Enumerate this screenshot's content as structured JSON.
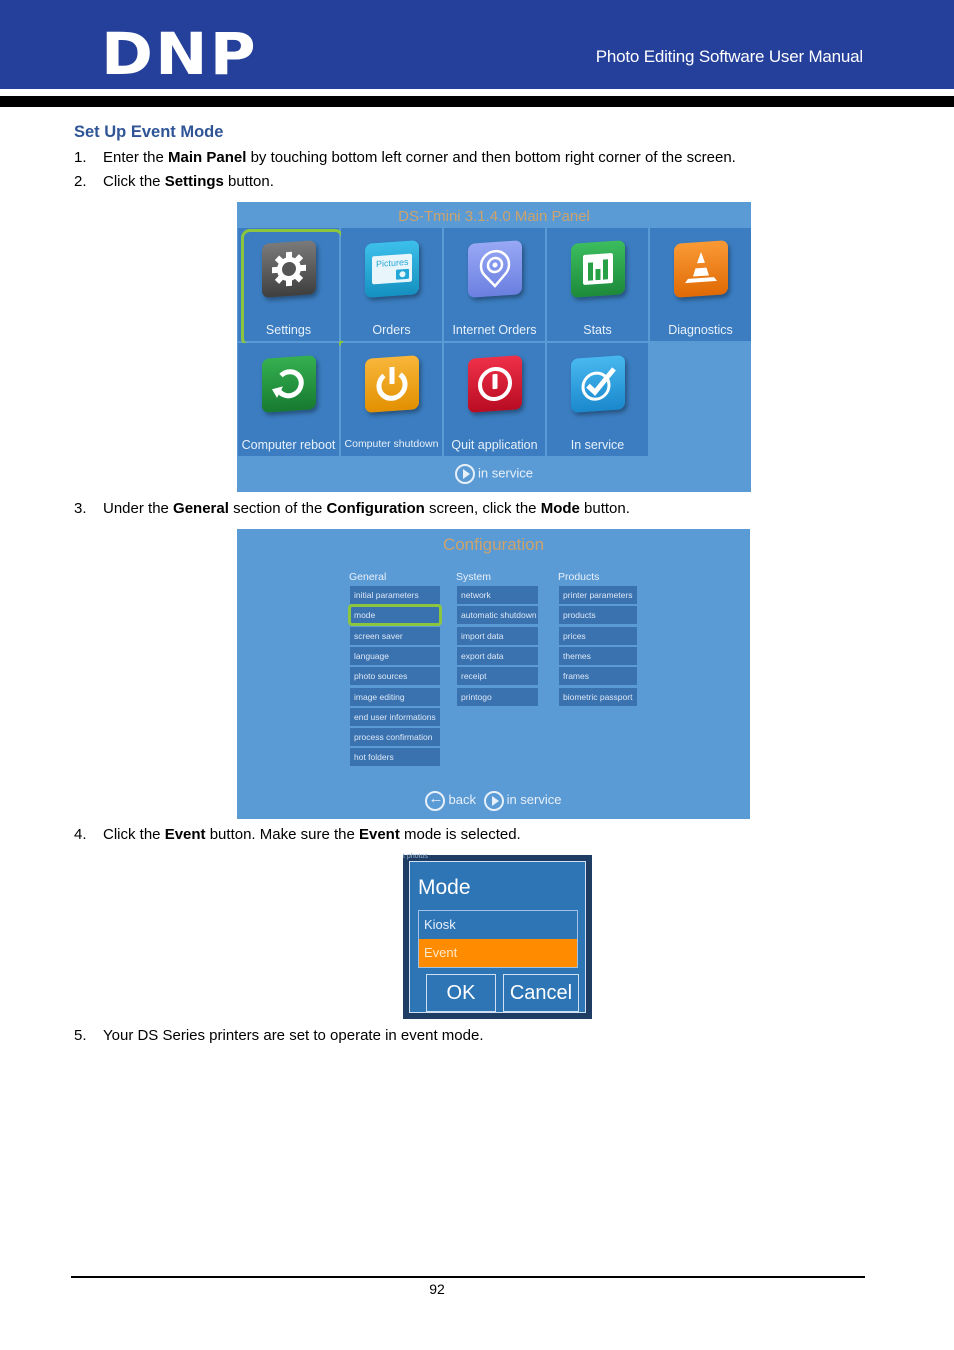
{
  "header": {
    "logo": "DNP",
    "manual_title": "Photo Editing Software User Manual",
    "colors": {
      "banner": "#24409a",
      "rule": "#000000"
    }
  },
  "section": {
    "title": "Set Up Event Mode",
    "title_color": "#2f5597"
  },
  "steps": [
    {
      "num": "1.",
      "parts": [
        {
          "t": "Enter the "
        },
        {
          "b": "Main Panel"
        },
        {
          "t": " by touching bottom left corner and then bottom right corner of the screen."
        }
      ]
    },
    {
      "num": "2.",
      "parts": [
        {
          "t": "Click the "
        },
        {
          "b": "Settings"
        },
        {
          "t": " button."
        }
      ]
    },
    {
      "num": "3.",
      "parts": [
        {
          "t": "Under the "
        },
        {
          "b": "General"
        },
        {
          "t": " section of the "
        },
        {
          "b": "Configuration"
        },
        {
          "t": " screen, click the "
        },
        {
          "b": "Mode"
        },
        {
          "t": " button."
        }
      ]
    },
    {
      "num": "4.",
      "parts": [
        {
          "t": "Click the "
        },
        {
          "b": "Event"
        },
        {
          "t": " button. Make sure the "
        },
        {
          "b": "Event"
        },
        {
          "t": " mode is selected."
        }
      ]
    },
    {
      "num": "5.",
      "parts": [
        {
          "t": "Your DS Series printers are set to operate in event mode."
        }
      ]
    }
  ],
  "main_panel": {
    "title": "DS-Tmini 3.1.4.0 Main Panel",
    "tiles": [
      {
        "label": "Settings",
        "icon": "gear-icon",
        "color": "#5a5a5a",
        "selected": true
      },
      {
        "label": "Orders",
        "icon": "pictures-folder-icon",
        "color": "#23a7d8",
        "icon_text": "Pictures"
      },
      {
        "label": "Internet Orders",
        "icon": "location-pin-icon",
        "color": "#7b8fe8"
      },
      {
        "label": "Stats",
        "icon": "bar-chart-icon",
        "color": "#27a046"
      },
      {
        "label": "Diagnostics",
        "icon": "traffic-cone-icon",
        "color": "#f07d16"
      },
      {
        "label": "Computer reboot",
        "icon": "refresh-icon",
        "color": "#22963f"
      },
      {
        "label": "Computer shutdown",
        "icon": "power-icon",
        "color": "#f0a010"
      },
      {
        "label": "Quit application",
        "icon": "quit-icon",
        "color": "#d8182f"
      },
      {
        "label": "In service",
        "icon": "checkmark-icon",
        "color": "#29a0e0"
      }
    ],
    "footer": "in service",
    "highlight_color": "#8cc63f"
  },
  "config_panel": {
    "title": "Configuration",
    "columns": [
      {
        "heading": "General",
        "items": [
          "initial parameters",
          "mode",
          "screen saver",
          "language",
          "photo sources",
          "image editing",
          "end user informations",
          "process confirmation",
          "hot folders"
        ],
        "selected": "mode"
      },
      {
        "heading": "System",
        "items": [
          "network",
          "automatic shutdown",
          "import data",
          "export data",
          "receipt",
          "printogo"
        ]
      },
      {
        "heading": "Products",
        "items": [
          "printer parameters",
          "products",
          "prices",
          "themes",
          "frames",
          "biometric passport"
        ]
      }
    ],
    "footer_back": "back",
    "footer_service": "in service"
  },
  "mode_dialog": {
    "ghost_text": "t photos",
    "title": "Mode",
    "options": [
      {
        "label": "Kiosk",
        "selected": false
      },
      {
        "label": "Event",
        "selected": true
      }
    ],
    "ok": "OK",
    "cancel": "Cancel",
    "selected_color": "#ff8c00"
  },
  "footer": {
    "page_number": "92"
  }
}
